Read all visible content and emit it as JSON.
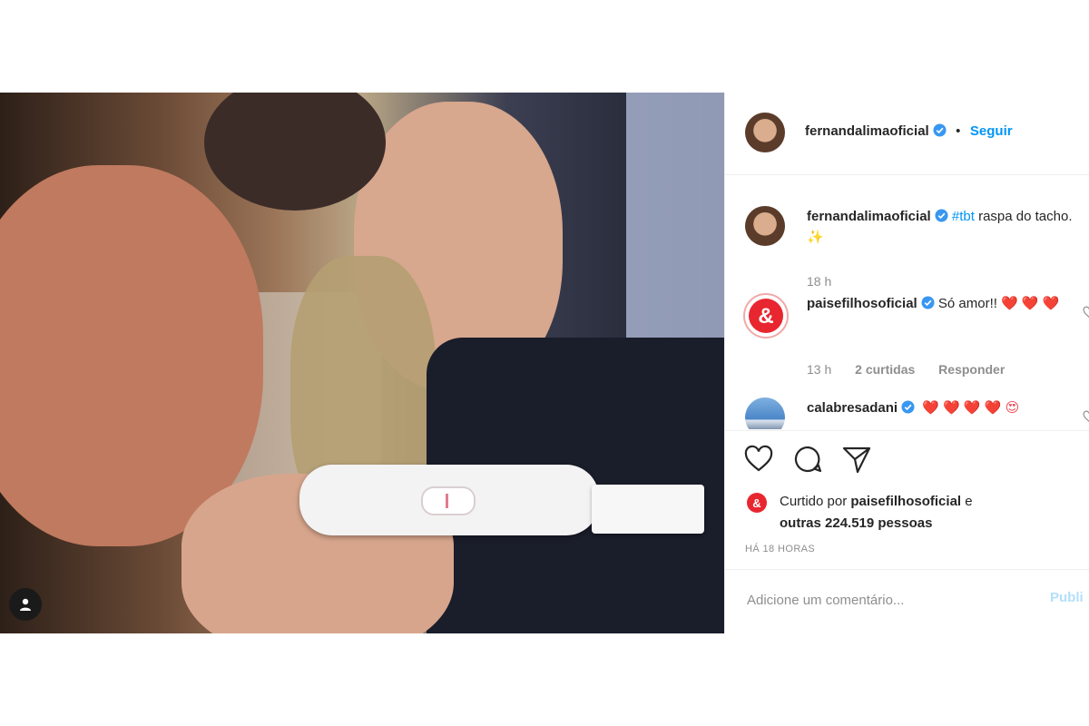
{
  "header": {
    "username": "fernandalimaoficial",
    "separator": "•",
    "follow_label": "Seguir"
  },
  "caption": {
    "username": "fernandalimaoficial",
    "hashtag": "#tbt",
    "text": "raspa do tacho.",
    "emoji": "✨",
    "time": "18 h"
  },
  "comments": [
    {
      "username": "paisefilhosoficial",
      "avatar_text": "&",
      "text": "Só amor!!",
      "hearts": "❤️ ❤️ ❤️",
      "time": "13 h",
      "likes": "2 curtidas",
      "reply_label": "Responder"
    },
    {
      "username": "calabresadani",
      "hearts": "❤️ ❤️ ❤️ ❤️ 😍"
    }
  ],
  "likes": {
    "avatar_text": "&",
    "prefix": "Curtido por",
    "user": "paisefilhosoficial",
    "conj": "e",
    "others": "outras 224.519 pessoas"
  },
  "timestamp": "HÁ 18 HORAS",
  "comment_box": {
    "placeholder": "Adicione um comentário...",
    "publish_label": "Publi"
  },
  "colors": {
    "link_blue": "#0095f6",
    "muted": "#8e8e8e",
    "heart_red": "#ed4956"
  }
}
